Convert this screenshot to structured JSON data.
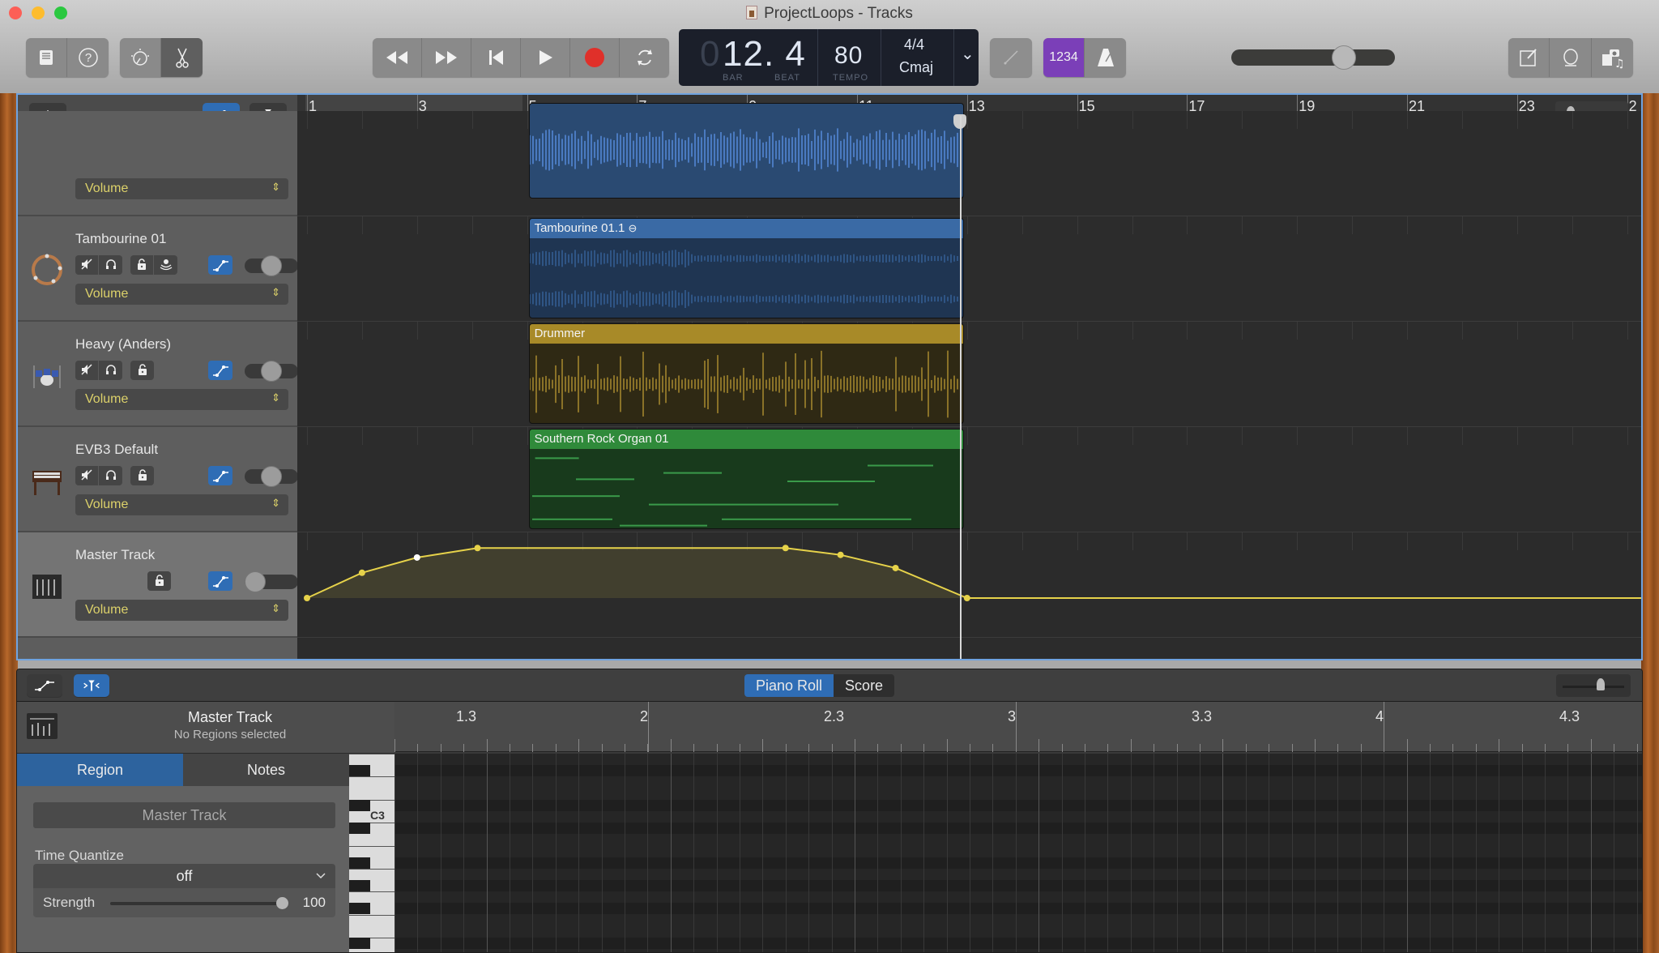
{
  "window": {
    "title": "ProjectLoops - Tracks",
    "traffic_colors": {
      "close": "#fc5f57",
      "minimize": "#fdbc2e",
      "zoom": "#2bc840"
    }
  },
  "toolbar": {
    "left_group1": [
      {
        "name": "library-button",
        "icon": "library-icon"
      },
      {
        "name": "quick-help-button",
        "icon": "help-icon",
        "glyph": "?"
      }
    ],
    "left_group2": [
      {
        "name": "smart-controls-button",
        "icon": "knob-icon"
      },
      {
        "name": "editors-button",
        "icon": "scissors-icon",
        "glyph": "✂"
      }
    ],
    "transport": [
      {
        "name": "rewind-button",
        "icon": "rewind-icon",
        "glyph": "◀◀"
      },
      {
        "name": "fast-forward-button",
        "icon": "fast-forward-icon",
        "glyph": "▶▶"
      },
      {
        "name": "go-to-beginning-button",
        "icon": "go-to-beginning-icon",
        "glyph": "⏮"
      },
      {
        "name": "play-button",
        "icon": "play-icon",
        "glyph": "▶"
      },
      {
        "name": "record-button",
        "icon": "record-icon",
        "glyph": "●"
      },
      {
        "name": "cycle-button",
        "icon": "cycle-icon",
        "glyph": "⟳"
      }
    ],
    "lcd": {
      "bar_prefix": "0",
      "position": "12. 4",
      "bar_label": "BAR",
      "beat_label": "BEAT",
      "tempo": "80",
      "tempo_label": "TEMPO",
      "time_signature": "4/4",
      "key": "Cmaj",
      "dropdown_glyph": "⌄"
    },
    "tuner_glyph": "⁄",
    "count_in": "1234",
    "count_in_color": "#7b3fb8",
    "metronome_glyph": "▲",
    "master_volume": 0.72,
    "right_group": [
      {
        "name": "notepad-button",
        "icon": "notepad-icon"
      },
      {
        "name": "apple-loops-button",
        "icon": "loop-icon"
      },
      {
        "name": "media-browser-button",
        "icon": "media-browser-icon"
      }
    ]
  },
  "tracks_header": {
    "add_glyph": "+"
  },
  "ruler": {
    "bars": [
      "1",
      "3",
      "5",
      "7",
      "9",
      "11",
      "13",
      "15",
      "17",
      "19",
      "21",
      "23",
      "2"
    ]
  },
  "tracks": [
    {
      "name": "",
      "volume_label": "Volume",
      "partial": true
    },
    {
      "name": "Tambourine 01",
      "volume_label": "Volume",
      "buttons": [
        "mute",
        "headphones",
        "lock",
        "record-enable"
      ],
      "toggle": 0.5
    },
    {
      "name": "Heavy (Anders)",
      "volume_label": "Volume",
      "buttons": [
        "mute",
        "headphones",
        "lock"
      ],
      "toggle": 0.5
    },
    {
      "name": "EVB3 Default",
      "volume_label": "Volume",
      "buttons": [
        "mute",
        "headphones",
        "lock"
      ],
      "toggle": 0.5
    },
    {
      "name": "Master Track",
      "volume_label": "Volume",
      "buttons": [
        "lock"
      ],
      "toggle": 0.0
    }
  ],
  "regions": [
    {
      "label": "",
      "color": "#2a4a72",
      "header_color": "#3a6aa5"
    },
    {
      "label": "Tambourine 01.1",
      "color": "#1f3552",
      "header_color": "#3a6aa5"
    },
    {
      "label": "Drummer",
      "color": "#2f2914",
      "header_color": "#a88a28"
    },
    {
      "label": "Southern Rock Organ 01",
      "color": "#183a1c",
      "header_color": "#2f8a3a"
    }
  ],
  "automation": {
    "color": "#e6d24a",
    "points_bar": [
      1.0,
      2.0,
      3.0,
      4.1,
      9.7,
      10.7,
      11.7,
      13.0
    ],
    "points_level": [
      0.0,
      0.48,
      0.77,
      0.95,
      0.95,
      0.82,
      0.57,
      0.0
    ]
  },
  "editor": {
    "seg": [
      {
        "label": "Piano Roll",
        "active": true
      },
      {
        "label": "Score",
        "active": false
      }
    ],
    "inspector": {
      "title": "Master Track",
      "subtitle": "No Regions selected",
      "tabs": [
        {
          "label": "Region",
          "active": true
        },
        {
          "label": "Notes",
          "active": false
        }
      ],
      "name_field": "Master Track",
      "time_quantize_label": "Time Quantize",
      "time_quantize_value": "off",
      "strength_label": "Strength",
      "strength_value": "100",
      "strength_fraction": 1.0
    },
    "ruler": [
      "1.3",
      "2",
      "2.3",
      "3",
      "3.3",
      "4",
      "4.3"
    ],
    "key_label": "C3"
  }
}
